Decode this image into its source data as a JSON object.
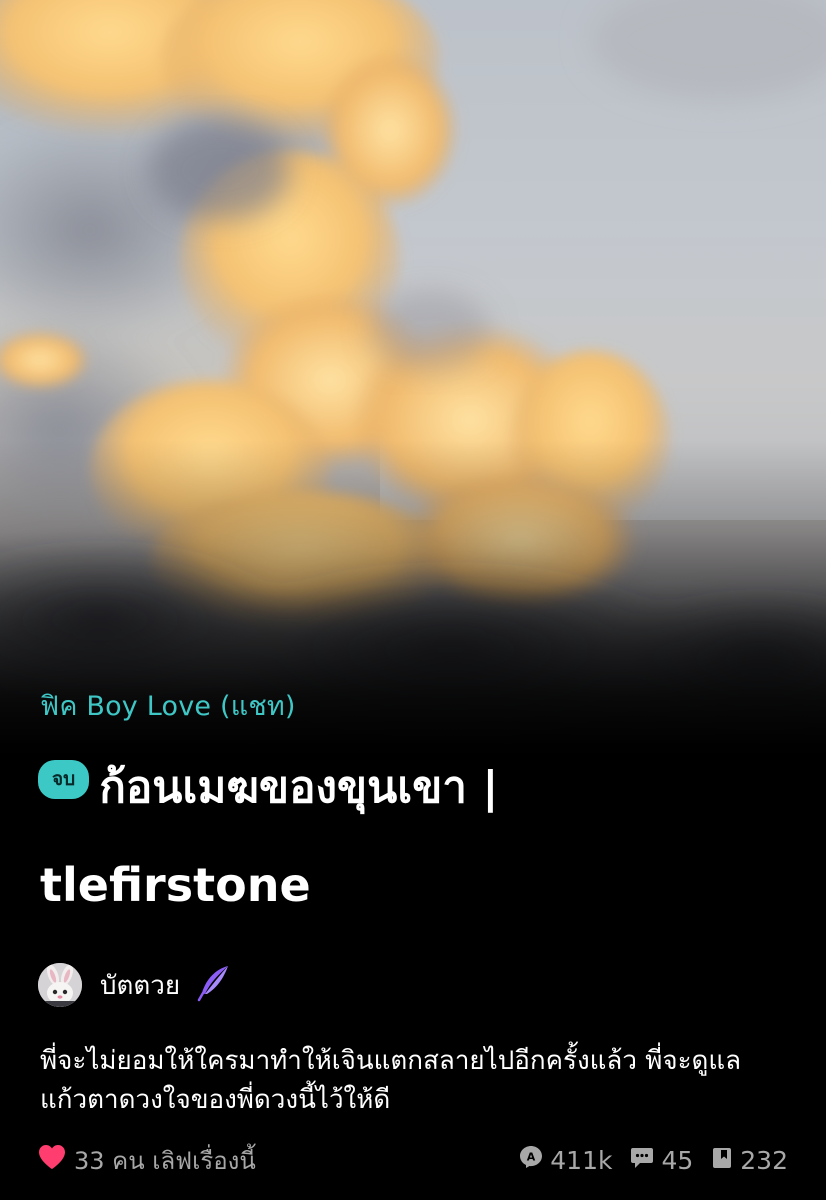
{
  "category": "ฟิค Boy Love (แชท)",
  "badge": "จบ",
  "title_line1": "ก้อนเมฆของขุนเขา |",
  "title_line2": "tlefirstone",
  "author": {
    "name": "บัตตวย",
    "avatar_icon": "bunny-avatar",
    "badge_icon": "quill-icon"
  },
  "description": "พี่จะไม่ยอมให้ใครมาทำให้เจินแตกสลายไปอีกครั้งแล้ว พี่จะดูแลแก้วตาดวงใจของพี่ดวงนี้ไว้ให้ดี",
  "love_text": "33 คน เลิฟเรื่องนี้",
  "stats": {
    "views": "411k",
    "comments": "45",
    "chapters": "232"
  },
  "colors": {
    "accent": "#3fc7c6",
    "heart": "#ff3d6e",
    "quill": "#8b5cf6",
    "muted": "#a8a8a8"
  }
}
